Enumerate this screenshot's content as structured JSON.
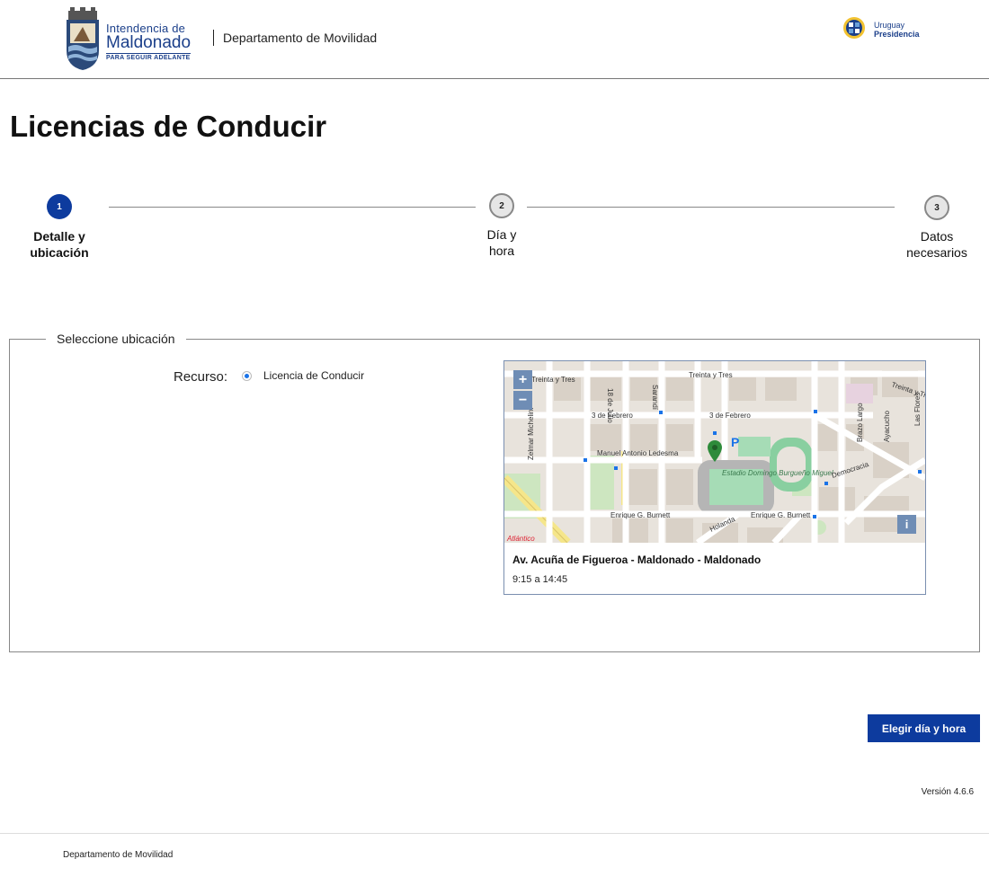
{
  "header": {
    "logo_line1": "Intendencia de",
    "logo_line2": "Maldonado",
    "logo_tagline": "PARA SEGUIR ADELANTE",
    "department": "Departamento de Movilidad",
    "presidencia_line1": "Uruguay",
    "presidencia_line2": "Presidencia"
  },
  "page_title": "Licencias de Conducir",
  "stepper": {
    "steps": [
      {
        "number": "1",
        "label_line1": "Detalle y",
        "label_line2": "ubicación",
        "active": true
      },
      {
        "number": "2",
        "label_line1": "Día y",
        "label_line2": "hora",
        "active": false
      },
      {
        "number": "3",
        "label_line1": "Datos",
        "label_line2": "necesarios",
        "active": false
      }
    ]
  },
  "location_section": {
    "legend": "Seleccione ubicación",
    "resource_label": "Recurso:",
    "resource_option": "Licencia de Conducir",
    "map": {
      "zoom_in": "+",
      "zoom_out": "−",
      "info": "i",
      "street_labels": [
        "Treinta y Tres",
        "Treinta y Tres",
        "18 de Julio",
        "Sarandí",
        "3 de Febrero",
        "3 de Febrero",
        "Manuel Antonio Ledesma",
        "Zelmar Michelini",
        "Estadio Domingo Burgueño Miguel",
        "Democracia",
        "Brazo Largo",
        "Ayacucho",
        "Las Flores",
        "Enrique G. Burnett",
        "Enrique G. Burnett",
        "Holanda",
        "Atlántico",
        "Treinta y Tr"
      ],
      "pin_color": "#2e8b3a"
    },
    "location_name": "Av. Acuña de Figueroa - Maldonado - Maldonado",
    "location_hours": "9:15 a 14:45"
  },
  "next_button": "Elegir día y hora",
  "version": "Versión 4.6.6",
  "footer": "Departamento de Movilidad",
  "colors": {
    "primary": "#0d3b9e",
    "map_control": "#6f8db5"
  }
}
